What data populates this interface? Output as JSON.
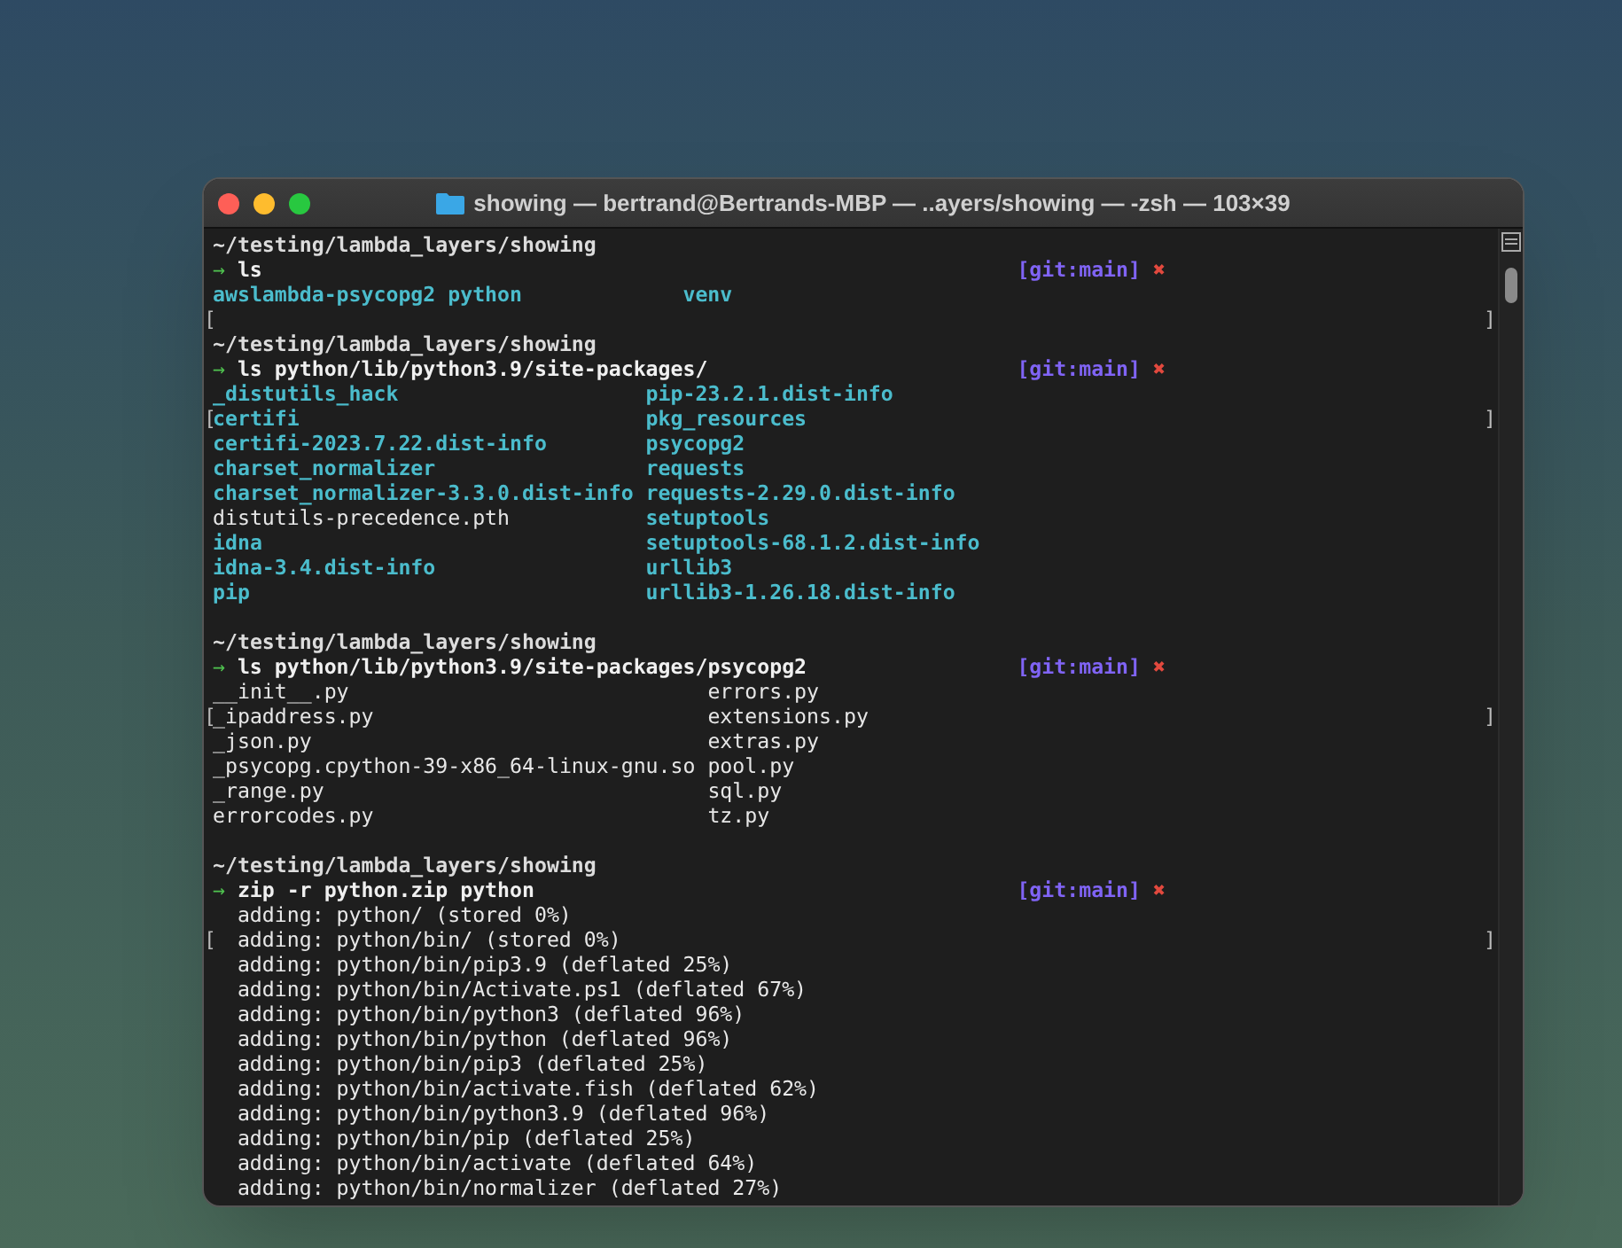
{
  "window": {
    "title": "showing — bertrand@Bertrands-MBP — ..ayers/showing — -zsh — 103×39"
  },
  "terminal": {
    "lines": [
      {
        "kind": "path",
        "text": "~/testing/lambda_layers/showing"
      },
      {
        "kind": "prompt",
        "arrow": "→",
        "command": "ls",
        "git": "[git:main]",
        "dirty": "✖"
      },
      {
        "kind": "listing",
        "cells": [
          {
            "text": "awslambda-psycopg2",
            "kind": "dir"
          },
          {
            "text": "python",
            "kind": "dir"
          },
          {
            "text": "venv",
            "kind": "dir"
          }
        ]
      },
      {
        "kind": "blank",
        "left_mark": "[",
        "right_mark": "]"
      },
      {
        "kind": "path",
        "text": "~/testing/lambda_layers/showing"
      },
      {
        "kind": "prompt",
        "arrow": "→",
        "command": "ls python/lib/python3.9/site-packages/",
        "git": "[git:main]",
        "dirty": "✖"
      },
      {
        "kind": "listing",
        "cells": [
          {
            "text": "_distutils_hack",
            "kind": "dir"
          },
          {
            "text": "pip-23.2.1.dist-info",
            "kind": "dir"
          }
        ]
      },
      {
        "kind": "listing",
        "left_mark": "[",
        "right_mark": "]",
        "cells": [
          {
            "text": "certifi",
            "kind": "dir"
          },
          {
            "text": "pkg_resources",
            "kind": "dir"
          }
        ]
      },
      {
        "kind": "listing",
        "cells": [
          {
            "text": "certifi-2023.7.22.dist-info",
            "kind": "dir"
          },
          {
            "text": "psycopg2",
            "kind": "dir"
          }
        ]
      },
      {
        "kind": "listing",
        "cells": [
          {
            "text": "charset_normalizer",
            "kind": "dir"
          },
          {
            "text": "requests",
            "kind": "dir"
          }
        ]
      },
      {
        "kind": "listing",
        "cells": [
          {
            "text": "charset_normalizer-3.3.0.dist-info",
            "kind": "dir"
          },
          {
            "text": "requests-2.29.0.dist-info",
            "kind": "dir"
          }
        ]
      },
      {
        "kind": "listing",
        "cells": [
          {
            "text": "distutils-precedence.pth",
            "kind": "file"
          },
          {
            "text": "setuptools",
            "kind": "dir"
          }
        ]
      },
      {
        "kind": "listing",
        "cells": [
          {
            "text": "idna",
            "kind": "dir"
          },
          {
            "text": "setuptools-68.1.2.dist-info",
            "kind": "dir"
          }
        ]
      },
      {
        "kind": "listing",
        "cells": [
          {
            "text": "idna-3.4.dist-info",
            "kind": "dir"
          },
          {
            "text": "urllib3",
            "kind": "dir"
          }
        ]
      },
      {
        "kind": "listing",
        "cells": [
          {
            "text": "pip",
            "kind": "dir"
          },
          {
            "text": "urllib3-1.26.18.dist-info",
            "kind": "dir"
          }
        ]
      },
      {
        "kind": "blank"
      },
      {
        "kind": "path",
        "text": "~/testing/lambda_layers/showing"
      },
      {
        "kind": "prompt",
        "arrow": "→",
        "command": "ls python/lib/python3.9/site-packages/psycopg2",
        "git": "[git:main]",
        "dirty": "✖"
      },
      {
        "kind": "listing",
        "cells": [
          {
            "text": "__init__.py",
            "kind": "file"
          },
          {
            "text": "errors.py",
            "kind": "file"
          }
        ]
      },
      {
        "kind": "listing",
        "left_mark": "[",
        "right_mark": "]",
        "cells": [
          {
            "text": "_ipaddress.py",
            "kind": "file"
          },
          {
            "text": "extensions.py",
            "kind": "file"
          }
        ]
      },
      {
        "kind": "listing",
        "cells": [
          {
            "text": "_json.py",
            "kind": "file"
          },
          {
            "text": "extras.py",
            "kind": "file"
          }
        ]
      },
      {
        "kind": "listing",
        "cells": [
          {
            "text": "_psycopg.cpython-39-x86_64-linux-gnu.so",
            "kind": "file"
          },
          {
            "text": "pool.py",
            "kind": "file"
          }
        ]
      },
      {
        "kind": "listing",
        "cells": [
          {
            "text": "_range.py",
            "kind": "file"
          },
          {
            "text": "sql.py",
            "kind": "file"
          }
        ]
      },
      {
        "kind": "listing",
        "cells": [
          {
            "text": "errorcodes.py",
            "kind": "file"
          },
          {
            "text": "tz.py",
            "kind": "file"
          }
        ]
      },
      {
        "kind": "blank"
      },
      {
        "kind": "path",
        "text": "~/testing/lambda_layers/showing"
      },
      {
        "kind": "prompt",
        "arrow": "→",
        "command": "zip -r python.zip python",
        "git": "[git:main]",
        "dirty": "✖"
      },
      {
        "kind": "output",
        "text": "adding: python/ (stored 0%)"
      },
      {
        "kind": "output",
        "left_mark": "[",
        "right_mark": "]",
        "text": "adding: python/bin/ (stored 0%)"
      },
      {
        "kind": "output",
        "text": "adding: python/bin/pip3.9 (deflated 25%)"
      },
      {
        "kind": "output",
        "text": "adding: python/bin/Activate.ps1 (deflated 67%)"
      },
      {
        "kind": "output",
        "text": "adding: python/bin/python3 (deflated 96%)"
      },
      {
        "kind": "output",
        "text": "adding: python/bin/python (deflated 96%)"
      },
      {
        "kind": "output",
        "text": "adding: python/bin/pip3 (deflated 25%)"
      },
      {
        "kind": "output",
        "text": "adding: python/bin/activate.fish (deflated 62%)"
      },
      {
        "kind": "output",
        "text": "adding: python/bin/python3.9 (deflated 96%)"
      },
      {
        "kind": "output",
        "text": "adding: python/bin/pip (deflated 25%)"
      },
      {
        "kind": "output",
        "text": "adding: python/bin/activate (deflated 64%)"
      },
      {
        "kind": "output",
        "text": "adding: python/bin/normalizer (deflated 27%)"
      }
    ]
  }
}
